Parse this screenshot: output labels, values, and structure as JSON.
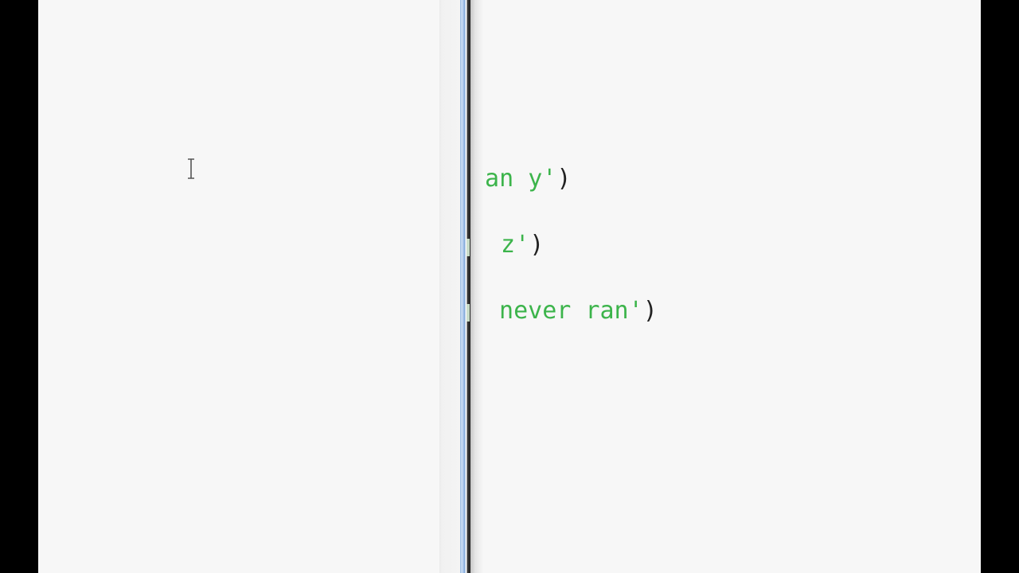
{
  "editor": {
    "right_pane": {
      "lines": [
        {
          "string_text": "han y'",
          "closing": ")"
        },
        {
          "string_text": " z'",
          "closing": ")"
        },
        {
          "string_text": " never ran'",
          "closing": ")"
        }
      ]
    }
  },
  "colors": {
    "string": "#3cb44b",
    "punctuation": "#222222",
    "background": "#f7f7f7",
    "splitter_accent": "#7ea6d8"
  },
  "icons": {
    "mouse_cursor": "text-ibeam-cursor-icon"
  }
}
